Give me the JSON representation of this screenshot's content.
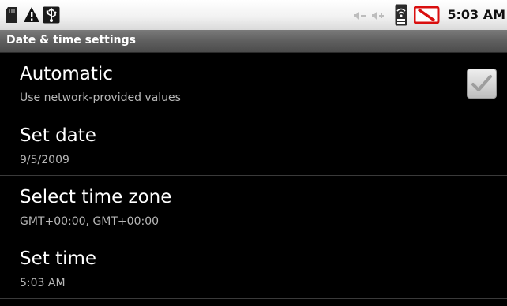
{
  "status_bar": {
    "time": "5:03 AM",
    "icons": [
      "sd-card-icon",
      "warning-icon",
      "usb-icon",
      "volume-down-icon",
      "volume-up-icon",
      "wifi-icon",
      "battery-charging-icon"
    ]
  },
  "title_bar": {
    "title": "Date & time settings"
  },
  "preferences": [
    {
      "title": "Automatic",
      "summary": "Use network-provided values",
      "checkbox": true,
      "checked": true
    },
    {
      "title": "Set date",
      "summary": "9/5/2009"
    },
    {
      "title": "Select time zone",
      "summary": "GMT+00:00, GMT+00:00"
    },
    {
      "title": "Set time",
      "summary": "5:03 AM"
    }
  ],
  "colors": {
    "background": "#000000",
    "title_text": "#ffffff",
    "summary_text": "#b8b8b8",
    "battery_alert": "#d90f0f"
  }
}
